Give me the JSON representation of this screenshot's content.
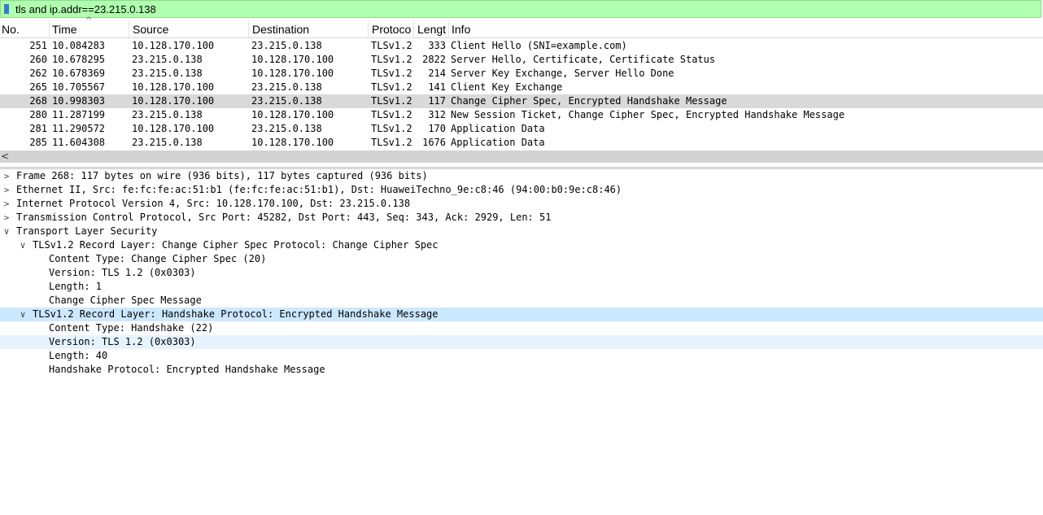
{
  "filter": {
    "value": "tls and ip.addr==23.215.0.138"
  },
  "columns": [
    "No.",
    "Time",
    "Source",
    "Destination",
    "Protoco",
    "Lengt",
    "Info"
  ],
  "packets": [
    {
      "no": "251",
      "time": "10.084283",
      "src": "10.128.170.100",
      "dst": "23.215.0.138",
      "proto": "TLSv1.2",
      "len": "333",
      "info": "Client Hello (SNI=example.com)"
    },
    {
      "no": "260",
      "time": "10.678295",
      "src": "23.215.0.138",
      "dst": "10.128.170.100",
      "proto": "TLSv1.2",
      "len": "2822",
      "info": "Server Hello, Certificate, Certificate Status"
    },
    {
      "no": "262",
      "time": "10.678369",
      "src": "23.215.0.138",
      "dst": "10.128.170.100",
      "proto": "TLSv1.2",
      "len": "214",
      "info": "Server Key Exchange, Server Hello Done"
    },
    {
      "no": "265",
      "time": "10.705567",
      "src": "10.128.170.100",
      "dst": "23.215.0.138",
      "proto": "TLSv1.2",
      "len": "141",
      "info": "Client Key Exchange"
    },
    {
      "no": "268",
      "time": "10.998303",
      "src": "10.128.170.100",
      "dst": "23.215.0.138",
      "proto": "TLSv1.2",
      "len": "117",
      "info": "Change Cipher Spec, Encrypted Handshake Message"
    },
    {
      "no": "280",
      "time": "11.287199",
      "src": "23.215.0.138",
      "dst": "10.128.170.100",
      "proto": "TLSv1.2",
      "len": "312",
      "info": "New Session Ticket, Change Cipher Spec, Encrypted Handshake Message"
    },
    {
      "no": "281",
      "time": "11.290572",
      "src": "10.128.170.100",
      "dst": "23.215.0.138",
      "proto": "TLSv1.2",
      "len": "170",
      "info": "Application Data"
    },
    {
      "no": "285",
      "time": "11.604308",
      "src": "23.215.0.138",
      "dst": "10.128.170.100",
      "proto": "TLSv1.2",
      "len": "1676",
      "info": "Application Data"
    }
  ],
  "selected_packet": "268",
  "details": [
    {
      "text": "Frame 268: 117 bytes on wire (936 bits), 117 bytes captured (936 bits)",
      "indent": 0,
      "toggle": "collapsed"
    },
    {
      "text": "Ethernet II, Src: fe:fc:fe:ac:51:b1 (fe:fc:fe:ac:51:b1), Dst: HuaweiTechno_9e:c8:46 (94:00:b0:9e:c8:46)",
      "indent": 0,
      "toggle": "collapsed"
    },
    {
      "text": "Internet Protocol Version 4, Src: 10.128.170.100, Dst: 23.215.0.138",
      "indent": 0,
      "toggle": "collapsed"
    },
    {
      "text": "Transmission Control Protocol, Src Port: 45282, Dst Port: 443, Seq: 343, Ack: 2929, Len: 51",
      "indent": 0,
      "toggle": "collapsed"
    },
    {
      "text": "Transport Layer Security",
      "indent": 0,
      "toggle": "expanded"
    },
    {
      "text": "TLSv1.2 Record Layer: Change Cipher Spec Protocol: Change Cipher Spec",
      "indent": 1,
      "toggle": "expanded"
    },
    {
      "text": "Content Type: Change Cipher Spec (20)",
      "indent": 2,
      "toggle": "none"
    },
    {
      "text": "Version: TLS 1.2 (0x0303)",
      "indent": 2,
      "toggle": "none"
    },
    {
      "text": "Length: 1",
      "indent": 2,
      "toggle": "none"
    },
    {
      "text": "Change Cipher Spec Message",
      "indent": 2,
      "toggle": "none"
    },
    {
      "text": "TLSv1.2 Record Layer: Handshake Protocol: Encrypted Handshake Message",
      "indent": 1,
      "toggle": "expanded",
      "highlight": "selected"
    },
    {
      "text": "Content Type: Handshake (22)",
      "indent": 2,
      "toggle": "none"
    },
    {
      "text": "Version: TLS 1.2 (0x0303)",
      "indent": 2,
      "toggle": "none",
      "highlight": "hover"
    },
    {
      "text": "Length: 40",
      "indent": 2,
      "toggle": "none"
    },
    {
      "text": "Handshake Protocol: Encrypted Handshake Message",
      "indent": 2,
      "toggle": "none"
    }
  ],
  "colors": {
    "filter_bg": "#afffaf",
    "selected_row": "#d9d9d9",
    "detail_selected": "#cce8ff",
    "detail_hover": "#e5f3ff"
  },
  "icons": {
    "bookmark": "bookmark-icon",
    "sort": "sort-ascending-icon",
    "scroll_left": "chevron-left-icon",
    "collapsed": "chevron-right-icon",
    "expanded": "chevron-down-icon"
  }
}
